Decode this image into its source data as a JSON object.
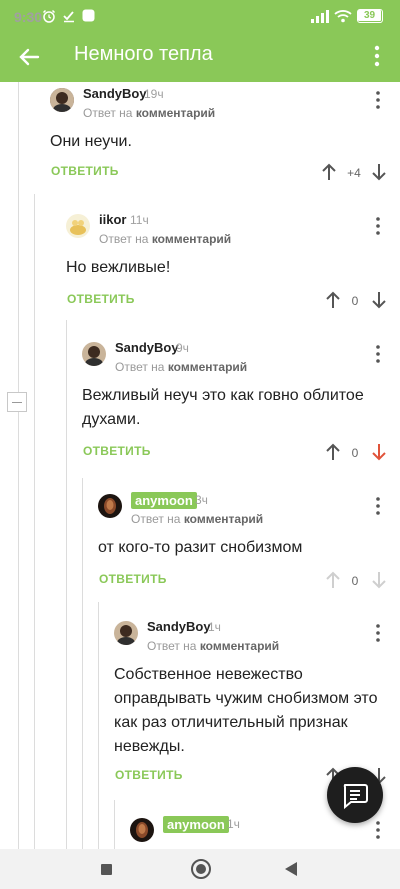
{
  "status_bar": {
    "time": "9:30",
    "battery": "39"
  },
  "app_bar": {
    "title": "Немного тепла",
    "back_icon": "arrow-left-icon",
    "menu_icon": "more-vertical-icon"
  },
  "labels": {
    "reply_to_prefix": "Ответ на",
    "reply_to_target": "комментарий",
    "reply_button": "ОТВЕТИТЬ"
  },
  "comments": [
    {
      "author": "SandyBoy",
      "time": "19ч",
      "text": "Они неучи.",
      "score": "+4",
      "vote": "none"
    },
    {
      "author": "iikor",
      "time": "11ч",
      "text": "Но вежливые!",
      "score": "0",
      "vote": "none"
    },
    {
      "author": "SandyBoy",
      "time": "9ч",
      "text": "Вежливый неуч это как говно облитое духами.",
      "score": "0",
      "vote": "down"
    },
    {
      "author": "anymoon",
      "author_badge": true,
      "time": "3ч",
      "text": "от кого-то разит снобизмом",
      "score": "0",
      "vote": "disabled"
    },
    {
      "author": "SandyBoy",
      "time": "1ч",
      "text": "Собственное невежество оправдывать чужим снобизмом это как раз отличительный признак невежды.",
      "score": "",
      "vote": "none"
    },
    {
      "author": "anymoon",
      "author_badge": true,
      "time": "1ч",
      "text": "",
      "score": "",
      "vote": "none"
    }
  ],
  "fab": {
    "icon": "comment-icon"
  },
  "colors": {
    "accent": "#8ac858",
    "downvote": "#e0533a",
    "fab": "#1e1e1e"
  }
}
